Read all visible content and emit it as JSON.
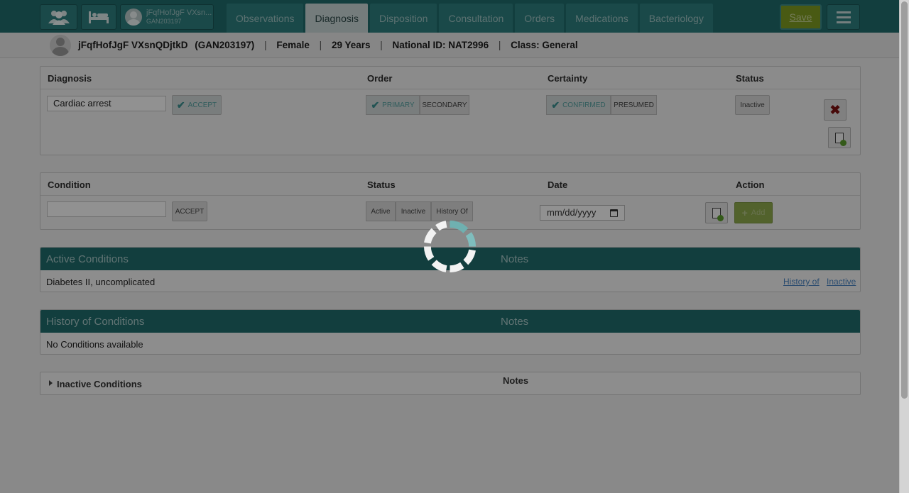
{
  "header": {
    "patient_chip": {
      "name": "jFqfHofJgF VXsn...",
      "id": "GAN203197"
    },
    "tabs": [
      {
        "label": "Observations"
      },
      {
        "label": "Diagnosis"
      },
      {
        "label": "Disposition"
      },
      {
        "label": "Consultation"
      },
      {
        "label": "Orders"
      },
      {
        "label": "Medications"
      },
      {
        "label": "Bacteriology"
      }
    ],
    "active_tab": "Diagnosis",
    "save_label": "Save",
    "icons": [
      "patients-icon",
      "bed-icon",
      "avatar-icon",
      "menu-icon"
    ]
  },
  "banner": {
    "name": "jFqfHofJgF VXsnQDjtkD",
    "id": "(GAN203197)",
    "gender": "Female",
    "age": "29 Years",
    "national_id": "National ID: NAT2996",
    "class": "Class: General"
  },
  "diagnosis": {
    "headers": {
      "diagnosis": "Diagnosis",
      "order": "Order",
      "certainty": "Certainty",
      "status": "Status"
    },
    "input_value": "Cardiac arrest",
    "accept_label": "ACCEPT",
    "order_options": [
      "PRIMARY",
      "SECONDARY"
    ],
    "certainty_options": [
      "CONFIRMED",
      "PRESUMED"
    ],
    "status_label": "Inactive"
  },
  "condition": {
    "headers": {
      "condition": "Condition",
      "status": "Status",
      "date": "Date",
      "action": "Action"
    },
    "input_value": "",
    "accept_label": "ACCEPT",
    "status_options": [
      "Active",
      "Inactive",
      "History Of"
    ],
    "date_placeholder": "mm/dd/yyyy",
    "add_label": "Add"
  },
  "active_conditions": {
    "title": "Active Conditions",
    "notes_label": "Notes",
    "rows": [
      {
        "name": "Diabetes II, uncomplicated",
        "link_history": "History of",
        "link_inactive": "Inactive"
      }
    ]
  },
  "history_conditions": {
    "title": "History of Conditions",
    "notes_label": "Notes",
    "empty_text": "No Conditions available"
  },
  "inactive_conditions": {
    "title": "Inactive Conditions",
    "notes_label": "Notes"
  },
  "colors": {
    "header_bg": "#1f6b6b",
    "save_bg": "#7f9b21",
    "link": "#4a84c0"
  }
}
